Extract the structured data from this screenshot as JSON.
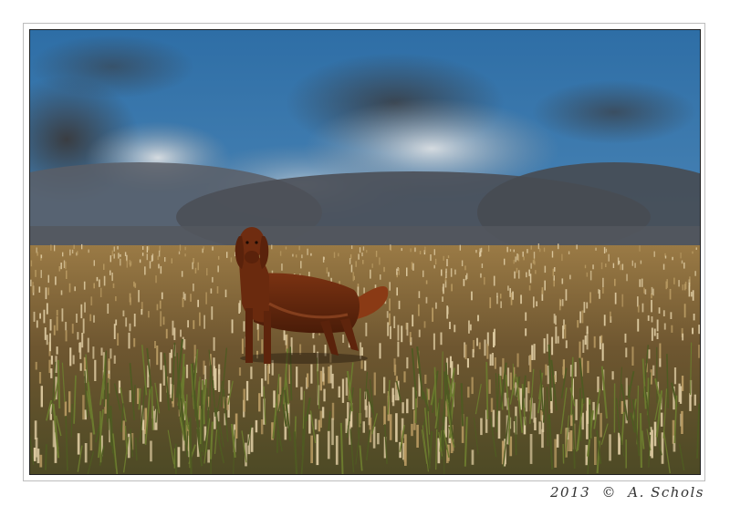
{
  "photo": {
    "subject": "dog-in-stubble-field",
    "colors": {
      "sky_top": "#2f6fa6",
      "sky_bottom": "#4a86b8",
      "cloud_dark": "#3e4248",
      "cloud_light": "#d9d9d9",
      "field": "#8a6a3a",
      "stubble": "#d8c79a",
      "dog": "#6b2a10",
      "grass": "#5a6b2a"
    }
  },
  "caption": {
    "year": "2013",
    "copyright_symbol": "©",
    "author": "A. Schols"
  }
}
